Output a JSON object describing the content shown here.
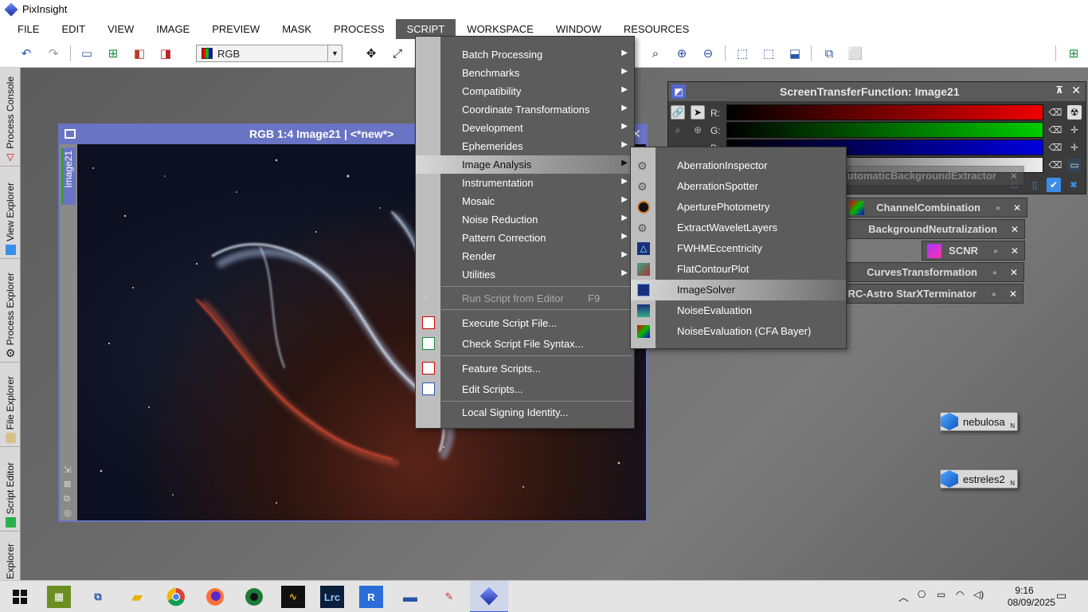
{
  "app_title": "PixInsight",
  "menubar": [
    "FILE",
    "EDIT",
    "VIEW",
    "IMAGE",
    "PREVIEW",
    "MASK",
    "PROCESS",
    "SCRIPT",
    "WORKSPACE",
    "WINDOW",
    "RESOURCES"
  ],
  "active_menu": "SCRIPT",
  "toolbar": {
    "rgb_select": "RGB"
  },
  "left_tabs": [
    "Process Console",
    "View Explorer",
    "Process Explorer",
    "File Explorer",
    "Script Editor",
    "Explorer"
  ],
  "image_window": {
    "title": "RGB 1:4 Image21 | <*new*>",
    "tab": "Image21"
  },
  "stf": {
    "title": "ScreenTransferFunction: Image21",
    "channels": [
      "R:",
      "G:",
      "B:"
    ]
  },
  "process_windows": [
    {
      "title": "AutomaticBackgroundExtractor"
    },
    {
      "title": "ChannelCombination"
    },
    {
      "title": "BackgroundNeutralization"
    },
    {
      "title": "SCNR"
    },
    {
      "title": "CurvesTransformation"
    },
    {
      "title": "RC-Astro StarXTerminator"
    }
  ],
  "script_menu": {
    "items": [
      {
        "label": "Batch Processing",
        "submenu": true
      },
      {
        "label": "Benchmarks",
        "submenu": true
      },
      {
        "label": "Compatibility",
        "submenu": true
      },
      {
        "label": "Coordinate Transformations",
        "submenu": true
      },
      {
        "label": "Development",
        "submenu": true
      },
      {
        "label": "Ephemerides",
        "submenu": true
      },
      {
        "label": "Image Analysis",
        "submenu": true,
        "highlighted": true
      },
      {
        "label": "Instrumentation",
        "submenu": true
      },
      {
        "label": "Mosaic",
        "submenu": true
      },
      {
        "label": "Noise Reduction",
        "submenu": true
      },
      {
        "label": "Pattern Correction",
        "submenu": true
      },
      {
        "label": "Render",
        "submenu": true
      },
      {
        "label": "Utilities",
        "submenu": true
      }
    ],
    "run_script": {
      "label": "Run Script from Editor",
      "shortcut": "F9"
    },
    "execute": "Execute Script File...",
    "check": "Check Script File Syntax...",
    "feature": "Feature Scripts...",
    "edit": "Edit Scripts...",
    "signing": "Local Signing Identity..."
  },
  "image_analysis_submenu": [
    {
      "label": "AberrationInspector"
    },
    {
      "label": "AberrationSpotter"
    },
    {
      "label": "AperturePhotometry"
    },
    {
      "label": "ExtractWaveletLayers"
    },
    {
      "label": "FWHMEccentricity"
    },
    {
      "label": "FlatContourPlot"
    },
    {
      "label": "ImageSolver",
      "highlighted": true
    },
    {
      "label": "NoiseEvaluation"
    },
    {
      "label": "NoiseEvaluation (CFA Bayer)"
    }
  ],
  "desktop_icons": [
    {
      "label": "nebulosa"
    },
    {
      "label": "estreles2"
    }
  ],
  "taskbar": {
    "lrc": "Lrc",
    "time": "9:16",
    "date": "08/09/2025"
  }
}
